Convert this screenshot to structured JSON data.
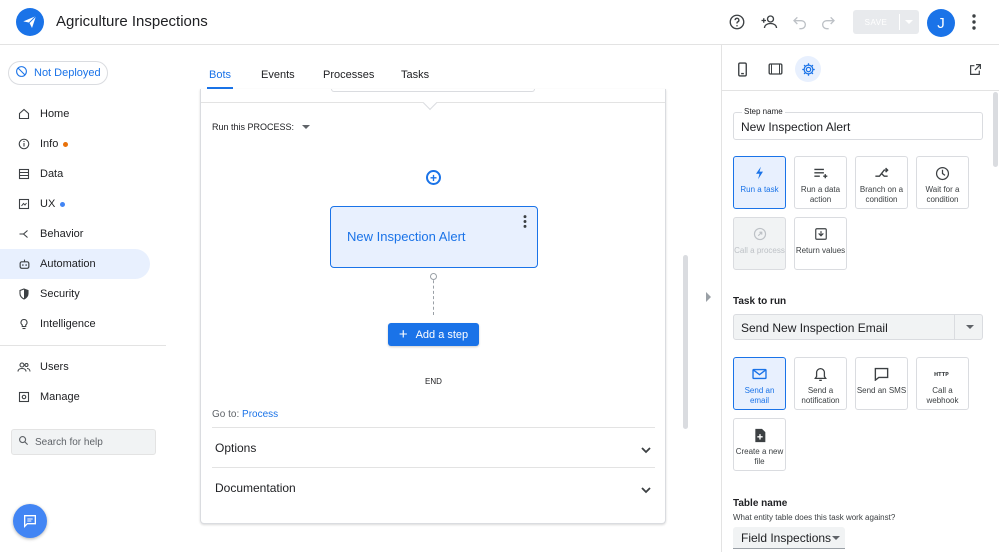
{
  "app": {
    "title": "Agriculture Inspections",
    "save_label": "SAVE",
    "avatar_initial": "J",
    "brand_color": "#1a73e8"
  },
  "sidebar": {
    "deploy_status": "Not Deployed",
    "items": [
      {
        "label": "Home",
        "icon": "home-icon"
      },
      {
        "label": "Info",
        "icon": "info-icon",
        "dot": "#e8710a"
      },
      {
        "label": "Data",
        "icon": "data-icon"
      },
      {
        "label": "UX",
        "icon": "ux-icon",
        "dot": "#4285f4"
      },
      {
        "label": "Behavior",
        "icon": "behavior-icon"
      },
      {
        "label": "Automation",
        "icon": "automation-icon",
        "active": true
      },
      {
        "label": "Security",
        "icon": "shield-icon"
      },
      {
        "label": "Intelligence",
        "icon": "lightbulb-icon"
      }
    ],
    "secondary_items": [
      {
        "label": "Users",
        "icon": "users-icon"
      },
      {
        "label": "Manage",
        "icon": "manage-icon"
      }
    ],
    "search_placeholder": "Search for help"
  },
  "main": {
    "tabs": [
      {
        "label": "Bots",
        "active": true
      },
      {
        "label": "Events"
      },
      {
        "label": "Processes"
      },
      {
        "label": "Tasks"
      }
    ],
    "run_process_label": "Run this PROCESS:",
    "step_name": "New Inspection Alert",
    "add_step_label": "Add a step",
    "end_label": "END",
    "goto_prefix": "Go to:",
    "goto_link": "Process",
    "accordions": [
      "Options",
      "Documentation"
    ]
  },
  "panel": {
    "step_name_label": "Step name",
    "step_name_value": "New Inspection Alert",
    "step_types": [
      {
        "label": "Run a task",
        "icon": "lightning-icon",
        "state": "selected"
      },
      {
        "label": "Run a data action",
        "icon": "data-action-icon",
        "state": "normal"
      },
      {
        "label": "Branch on a condition",
        "icon": "branch-icon",
        "state": "normal"
      },
      {
        "label": "Wait for a condition",
        "icon": "clock-icon",
        "state": "normal"
      },
      {
        "label": "Call a process",
        "icon": "call-process-icon",
        "state": "disabled"
      },
      {
        "label": "Return values",
        "icon": "return-icon",
        "state": "normal"
      }
    ],
    "task_to_run_label": "Task to run",
    "task_to_run_value": "Send New Inspection Email",
    "task_types": [
      {
        "label": "Send an email",
        "icon": "mail-icon",
        "state": "selected"
      },
      {
        "label": "Send a notification",
        "icon": "bell-icon",
        "state": "normal"
      },
      {
        "label": "Send an SMS",
        "icon": "sms-icon",
        "state": "normal"
      },
      {
        "label": "Call a webhook",
        "icon": "http-icon",
        "state": "normal"
      },
      {
        "label": "Create a new file",
        "icon": "new-file-icon",
        "state": "normal"
      }
    ],
    "table_name_label": "Table name",
    "table_name_hint": "What entity table does this task work against?",
    "table_name_value": "Field Inspections"
  }
}
